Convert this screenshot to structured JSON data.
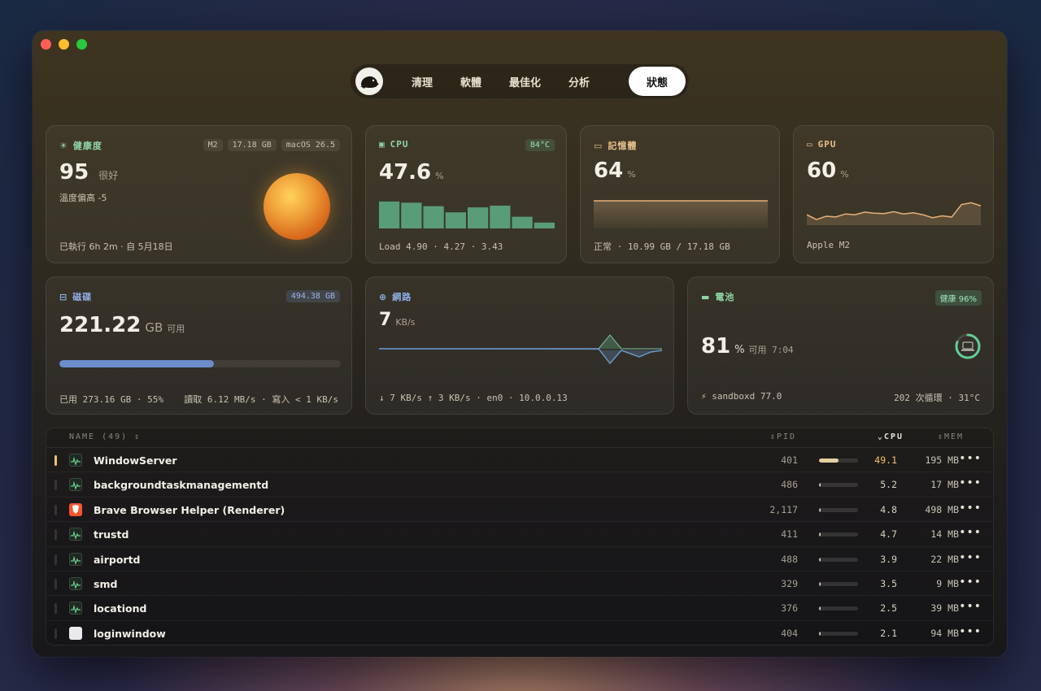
{
  "tabs": [
    "清理",
    "軟體",
    "最佳化",
    "分析",
    "狀態"
  ],
  "health": {
    "title": "健康度",
    "tags": [
      "M2",
      "17.18 GB",
      "macOS 26.5"
    ],
    "score": "95",
    "score_label": "很好",
    "temp_note": "溫度偏高 -5",
    "uptime": "已執行 6h 2m · 自 5月18日"
  },
  "cpu": {
    "title": "CPU",
    "badge": "84°C",
    "value": "47.6",
    "unit": "%",
    "load": "Load 4.90 · 4.27 · 3.43",
    "core_usage": [
      0.92,
      0.88,
      0.76,
      0.55,
      0.72,
      0.78,
      0.4,
      0.2
    ],
    "color": "#5fae86"
  },
  "memory": {
    "title": "記憶體",
    "value": "64",
    "unit": "%",
    "foot": "正常 · 10.99 GB / 17.18 GB",
    "color": "#e6b078"
  },
  "gpu": {
    "title": "GPU",
    "value": "60",
    "unit": "%",
    "foot": "Apple M2",
    "history": [
      0.28,
      0.15,
      0.24,
      0.22,
      0.3,
      0.28,
      0.35,
      0.32,
      0.31,
      0.36,
      0.3,
      0.33,
      0.28,
      0.2,
      0.25,
      0.22,
      0.55,
      0.6,
      0.52
    ],
    "color": "#e6b078"
  },
  "disk": {
    "title": "磁碟",
    "badge": "494.38 GB",
    "value": "221.22",
    "unit": "GB",
    "avail": "可用",
    "used_fraction": 0.55,
    "used_text": "已用 273.16 GB · 55%",
    "io_text": "讀取 6.12 MB/s · 寫入 < 1 KB/s",
    "color": "#6c8ccc"
  },
  "network": {
    "title": "網路",
    "value": "7",
    "unit": "KB/s",
    "foot": "↓ 7 KB/s  ↑ 3 KB/s · en0 · 10.0.0.13",
    "color": "#6a9ed6"
  },
  "battery": {
    "title": "電池",
    "badge": "健康 96%",
    "value": "81",
    "unit": "%",
    "remain": "可用 7:04",
    "proc": "sandboxd 77.0",
    "cycles": "202 次循環 · 31°C",
    "level": 0.81,
    "color": "#5fcf92"
  },
  "processes": {
    "header": {
      "name": "NAME (49)",
      "pid": "PID",
      "cpu": "CPU",
      "mem": "MEM"
    },
    "rows": [
      {
        "name": "WindowServer",
        "pid": "401",
        "cpu": "49.1",
        "cpu_fraction": 0.49,
        "mem": "195 MB",
        "icon": "activity-icon"
      },
      {
        "name": "backgroundtaskmanagementd",
        "pid": "486",
        "cpu": "5.2",
        "cpu_fraction": 0.052,
        "mem": "17 MB",
        "icon": "activity-icon"
      },
      {
        "name": "Brave Browser Helper (Renderer)",
        "pid": "2,117",
        "cpu": "4.8",
        "cpu_fraction": 0.048,
        "mem": "498 MB",
        "icon": "brave-icon"
      },
      {
        "name": "trustd",
        "pid": "411",
        "cpu": "4.7",
        "cpu_fraction": 0.047,
        "mem": "14 MB",
        "icon": "activity-icon"
      },
      {
        "name": "airportd",
        "pid": "488",
        "cpu": "3.9",
        "cpu_fraction": 0.039,
        "mem": "22 MB",
        "icon": "activity-icon"
      },
      {
        "name": "smd",
        "pid": "329",
        "cpu": "3.5",
        "cpu_fraction": 0.035,
        "mem": "9 MB",
        "icon": "activity-icon"
      },
      {
        "name": "locationd",
        "pid": "376",
        "cpu": "2.5",
        "cpu_fraction": 0.025,
        "mem": "39 MB",
        "icon": "activity-icon"
      },
      {
        "name": "loginwindow",
        "pid": "404",
        "cpu": "2.1",
        "cpu_fraction": 0.021,
        "mem": "94 MB",
        "icon": "blank-app-icon"
      }
    ]
  }
}
